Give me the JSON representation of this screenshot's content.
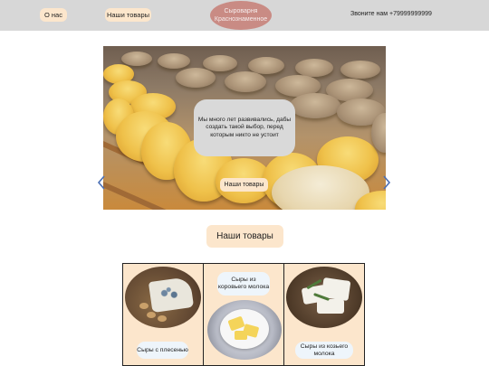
{
  "header": {
    "nav": [
      {
        "label": "О нас"
      },
      {
        "label": "Наши товары"
      }
    ],
    "logo": {
      "line1": "Сыроварня",
      "line2": "Краснознаменное"
    },
    "phone": "Звоните нам +79999999999"
  },
  "hero": {
    "slogan": "Мы много лет развивались, дабы создать такой выбор, перед которым никто не устоит",
    "button_label": "Наши товары",
    "prev_icon": "chevron-left-icon",
    "next_icon": "chevron-right-icon",
    "arrow_color": "#4a6fb5"
  },
  "products_section": {
    "title": "Наши товары",
    "items": [
      {
        "label": "Сыры с плесенью"
      },
      {
        "label": "Сыры из коровьего молока"
      },
      {
        "label": "Сыры из козьего молока"
      }
    ]
  },
  "colors": {
    "header_bg": "#d7d7d7",
    "button_bg": "#fce6cc",
    "logo_bg": "#c98b84",
    "bubble_bg": "#d9d9d9",
    "label_bg": "#eef5fb"
  }
}
